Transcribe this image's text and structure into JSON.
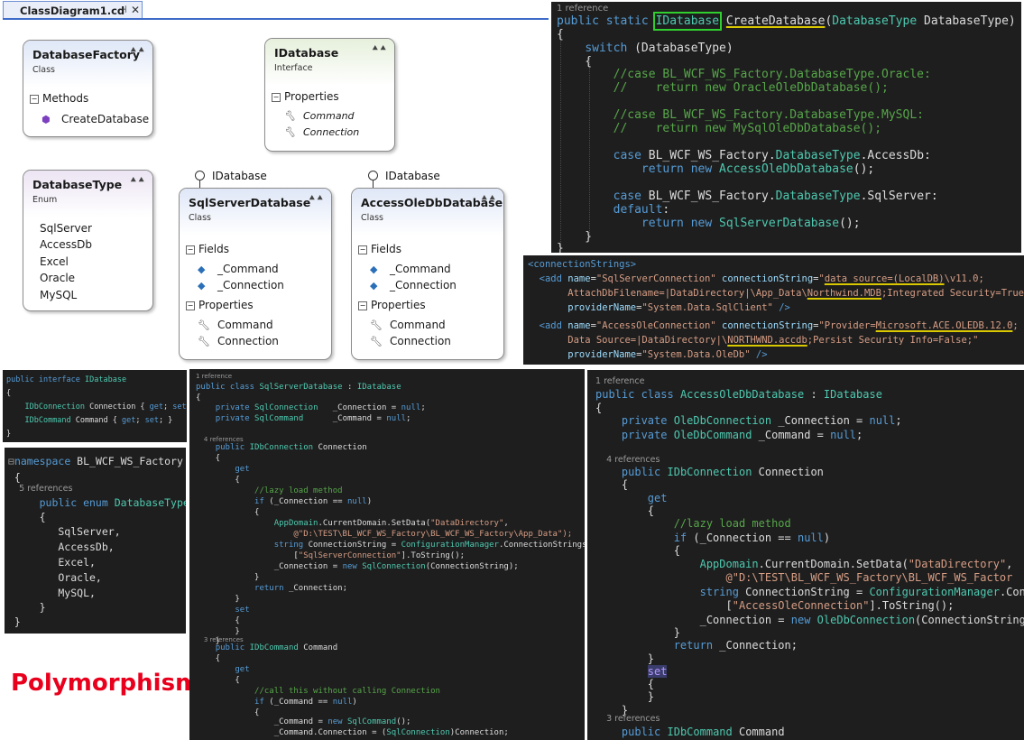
{
  "designer": {
    "tab_title": "ClassDiagram1.cd",
    "tab_pin": "⊣",
    "tab_close": "✕",
    "shapes": {
      "factory": {
        "name": "DatabaseFactory",
        "kind": "Class",
        "section": "Methods",
        "members": [
          "CreateDatabase"
        ]
      },
      "idatabase": {
        "name": "IDatabase",
        "kind": "Interface",
        "section": "Properties",
        "members": [
          "Command",
          "Connection"
        ]
      },
      "dbtype": {
        "name": "DatabaseType",
        "kind": "Enum",
        "members": [
          "SqlServer",
          "AccessDb",
          "Excel",
          "Oracle",
          "MySQL"
        ]
      },
      "sqlserver": {
        "name": "SqlServerDatabase",
        "kind": "Class",
        "lollipop": "IDatabase",
        "fields_label": "Fields",
        "fields": [
          "_Command",
          "_Connection"
        ],
        "props_label": "Properties",
        "props": [
          "Command",
          "Connection"
        ]
      },
      "access": {
        "name": "AccessOleDbDatabase",
        "kind": "Class",
        "lollipop": "IDatabase",
        "fields_label": "Fields",
        "fields": [
          "_Command",
          "_Connection"
        ],
        "props_label": "Properties",
        "props": [
          "Command",
          "Connection"
        ]
      }
    }
  },
  "factory_code": {
    "ref": "1 reference",
    "lines": [
      "public static IDatabase CreateDatabase(DatabaseType DatabaseType)",
      "{",
      "    switch (DatabaseType)",
      "    {",
      "        //case BL_WCF_WS_Factory.DatabaseType.Oracle:",
      "        //    return new OracleOleDbDatabase();",
      "",
      "        //case BL_WCF_WS_Factory.DatabaseType.MySQL:",
      "        //    return new MySqlOleDbDatabase();",
      "",
      "        case BL_WCF_WS_Factory.DatabaseType.AccessDb:",
      "            return new AccessOleDbDatabase();",
      "",
      "        case BL_WCF_WS_Factory.DatabaseType.SqlServer:",
      "        default:",
      "            return new SqlServerDatabase();",
      "    }",
      "}"
    ]
  },
  "config_code": {
    "lines": [
      "<connectionStrings>",
      "  <add name=\"SqlServerConnection\" connectionString=\"data source=(LocalDB)\\v11.0;",
      "       AttachDbFilename=|DataDirectory|\\App_Data\\Northwind.MDB;Integrated Security=True;\"",
      "       providerName=\"System.Data.SqlClient\" />",
      "  <add name=\"AccessOleConnection\" connectionString=\"Provider=Microsoft.ACE.OLEDB.12.0;",
      "       Data Source=|DataDirectory|\\NORTHWND.accdb;Persist Security Info=False;\"",
      "       providerName=\"System.Data.OleDb\" />"
    ]
  },
  "interface_code": {
    "lines": [
      "public interface IDatabase",
      "{",
      "    IDbConnection Connection { get; set; }",
      "    IDbCommand Command { get; set; }",
      "}"
    ]
  },
  "enum_code": {
    "lines": [
      "namespace BL_WCF_WS_Factory",
      "{",
      "    5 references",
      "    public enum DatabaseType",
      "    {",
      "        SqlServer,",
      "        AccessDb,",
      "        Excel,",
      "        Oracle,",
      "        MySQL,",
      "    }",
      "}"
    ]
  },
  "sql_code": {
    "lines": [
      "1 reference",
      "public class SqlServerDatabase : IDatabase",
      "{",
      "    private SqlConnection   _Connection = null;",
      "    private SqlCommand      _Command = null;",
      "",
      "    4 references",
      "    public IDbConnection Connection",
      "    {",
      "        get",
      "        {",
      "            //lazy load method",
      "            if (_Connection == null)",
      "            {",
      "                AppDomain.CurrentDomain.SetData(\"DataDirectory\",",
      "                    @\"D:\\TEST\\BL_WCF_WS_Factory\\BL_WCF_WS_Factory\\App_Data\");",
      "                string ConnectionString = ConfigurationManager.ConnectionStrings",
      "                    [\"SqlServerConnection\"].ToString();",
      "                _Connection = new SqlConnection(ConnectionString);",
      "            }",
      "            return _Connection;",
      "        }",
      "        set",
      "        {",
      "        }",
      "    }",
      "    3 references",
      "    public IDbCommand Command",
      "    {",
      "        get",
      "        {",
      "            //call this without calling Connection",
      "            if (_Command == null)",
      "            {",
      "                _Command = new SqlCommand();",
      "                _Command.Connection = (SqlConnection)Connection;",
      "            }"
    ]
  },
  "access_code": {
    "lines": [
      "1 reference",
      "public class AccessOleDbDatabase : IDatabase",
      "{",
      "    private OleDbConnection _Connection = null;",
      "    private OleDbCommand _Command = null;",
      "",
      "    4 references",
      "    public IDbConnection Connection",
      "    {",
      "        get",
      "        {",
      "            //lazy load method",
      "            if (_Connection == null)",
      "            {",
      "                AppDomain.CurrentDomain.SetData(\"DataDirectory\",",
      "                    @\"D:\\TEST\\BL_WCF_WS_Factory\\BL_WCF_WS_Factor",
      "                string ConnectionString = ConfigurationManager.Conne",
      "                    [\"AccessOleConnection\"].ToString();",
      "                _Connection = new OleDbConnection(ConnectionString);",
      "            }",
      "            return _Connection;",
      "        }",
      "        set",
      "        {",
      "        }",
      "    }",
      "    3 references",
      "    public IDbCommand Command"
    ]
  },
  "caption": "Polymorphism"
}
